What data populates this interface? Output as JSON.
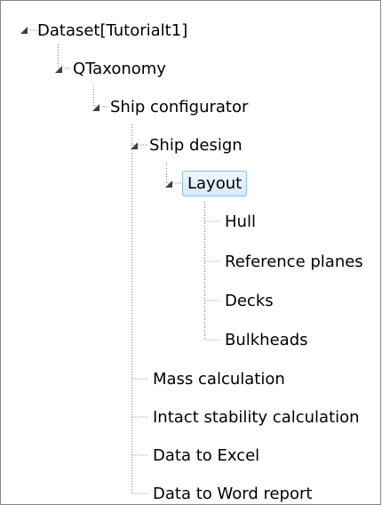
{
  "tree": {
    "root": "Dataset[Tutorialt1]",
    "taxonomy": "QTaxonomy",
    "configurator": "Ship configurator",
    "design": "Ship design",
    "layout": "Layout",
    "layout_children": [
      "Hull",
      "Reference planes",
      "Decks",
      "Bulkheads"
    ],
    "tools": [
      "Mass calculation",
      "Intact stability calculation",
      "Data to Excel",
      "Data to Word report"
    ],
    "selected": "Layout"
  },
  "icons": {
    "expanded": "expanded-triangle-icon"
  },
  "colors": {
    "line": "#7a7a7a",
    "selection_fill": "#dcecfc",
    "selection_border": "#8fbbe8",
    "toggle": "#404040"
  }
}
